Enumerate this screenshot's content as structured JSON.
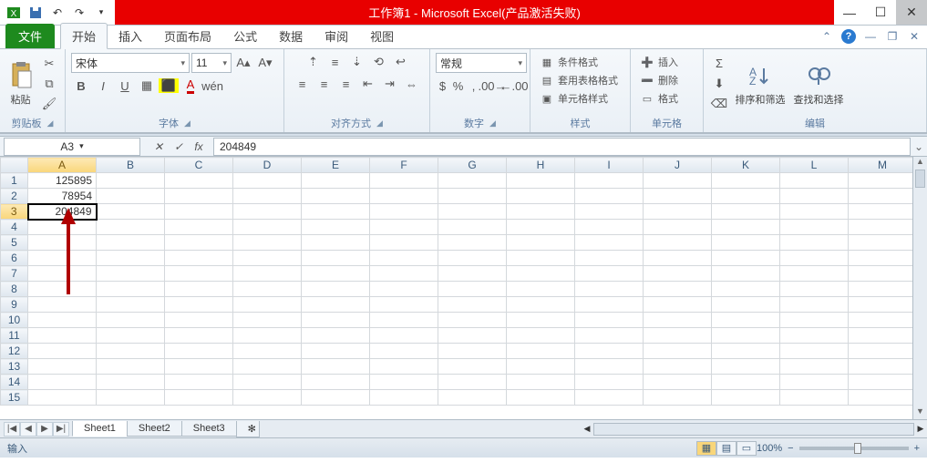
{
  "title": "工作簿1 - Microsoft Excel(产品激活失败)",
  "tabs": {
    "file": "文件",
    "home": "开始",
    "insert": "插入",
    "layout": "页面布局",
    "formulas": "公式",
    "data": "数据",
    "review": "审阅",
    "view": "视图"
  },
  "ribbon": {
    "clipboard": {
      "paste": "粘贴",
      "label": "剪贴板"
    },
    "font": {
      "name": "宋体",
      "size": "11",
      "label": "字体",
      "bold": "B",
      "italic": "I",
      "underline": "U"
    },
    "alignment": {
      "label": "对齐方式"
    },
    "number": {
      "format": "常规",
      "label": "数字"
    },
    "styles": {
      "cond": "条件格式",
      "tablefmt": "套用表格格式",
      "cellstyle": "单元格样式",
      "label": "样式"
    },
    "cells": {
      "insert": "插入",
      "delete": "删除",
      "format": "格式",
      "label": "单元格"
    },
    "editing": {
      "sort": "排序和筛选",
      "find": "查找和选择",
      "label": "编辑"
    }
  },
  "namebox": "A3",
  "formula": "204849",
  "columns": [
    "A",
    "B",
    "C",
    "D",
    "E",
    "F",
    "G",
    "H",
    "I",
    "J",
    "K",
    "L",
    "M"
  ],
  "rows": [
    1,
    2,
    3,
    4,
    5,
    6,
    7,
    8,
    9,
    10,
    11,
    12,
    13,
    14,
    15
  ],
  "cells": {
    "A1": "125895",
    "A2": "78954",
    "A3": "204849"
  },
  "sheets": [
    "Sheet1",
    "Sheet2",
    "Sheet3"
  ],
  "status": {
    "mode": "输入",
    "zoom": "100%"
  }
}
